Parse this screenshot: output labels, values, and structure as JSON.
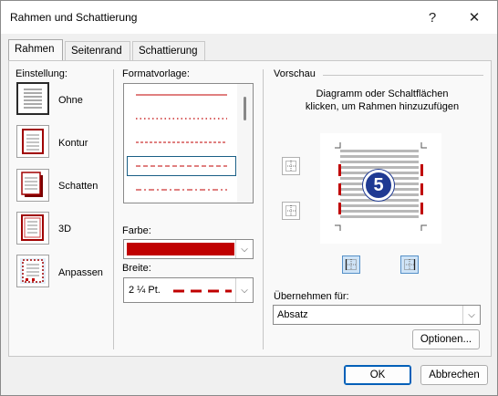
{
  "window": {
    "title": "Rahmen und Schattierung",
    "help_glyph": "?",
    "close_glyph": "✕"
  },
  "tabs": [
    {
      "label": "Rahmen",
      "active": true
    },
    {
      "label": "Seitenrand",
      "active": false
    },
    {
      "label": "Schattierung",
      "active": false
    }
  ],
  "settings": {
    "heading": "Einstellung:",
    "items": [
      {
        "label": "Ohne",
        "icon": "setting-none-icon",
        "selected": true
      },
      {
        "label": "Kontur",
        "icon": "setting-box-icon",
        "selected": false
      },
      {
        "label": "Schatten",
        "icon": "setting-shadow-icon",
        "selected": false
      },
      {
        "label": "3D",
        "icon": "setting-3d-icon",
        "selected": false
      },
      {
        "label": "Anpassen",
        "icon": "setting-custom-icon",
        "selected": false
      }
    ]
  },
  "style": {
    "heading": "Formatvorlage:",
    "line_styles": [
      "solid",
      "dotted",
      "dash-small",
      "dash-large",
      "dash-dot"
    ],
    "selected_index": 3,
    "line_color": "#c00000"
  },
  "color": {
    "label": "Farbe:",
    "value_color": "#c00000"
  },
  "width": {
    "label": "Breite:",
    "value": "2 ¼ Pt."
  },
  "preview": {
    "heading": "Vorschau",
    "hint": "Diagramm oder Schaltflächen klicken, um Rahmen hinzuzufügen",
    "badge": "5",
    "border_color": "#c00000"
  },
  "apply": {
    "label": "Übernehmen für:",
    "value": "Absatz"
  },
  "buttons": {
    "options": "Optionen...",
    "ok": "OK",
    "cancel": "Abbrechen"
  }
}
